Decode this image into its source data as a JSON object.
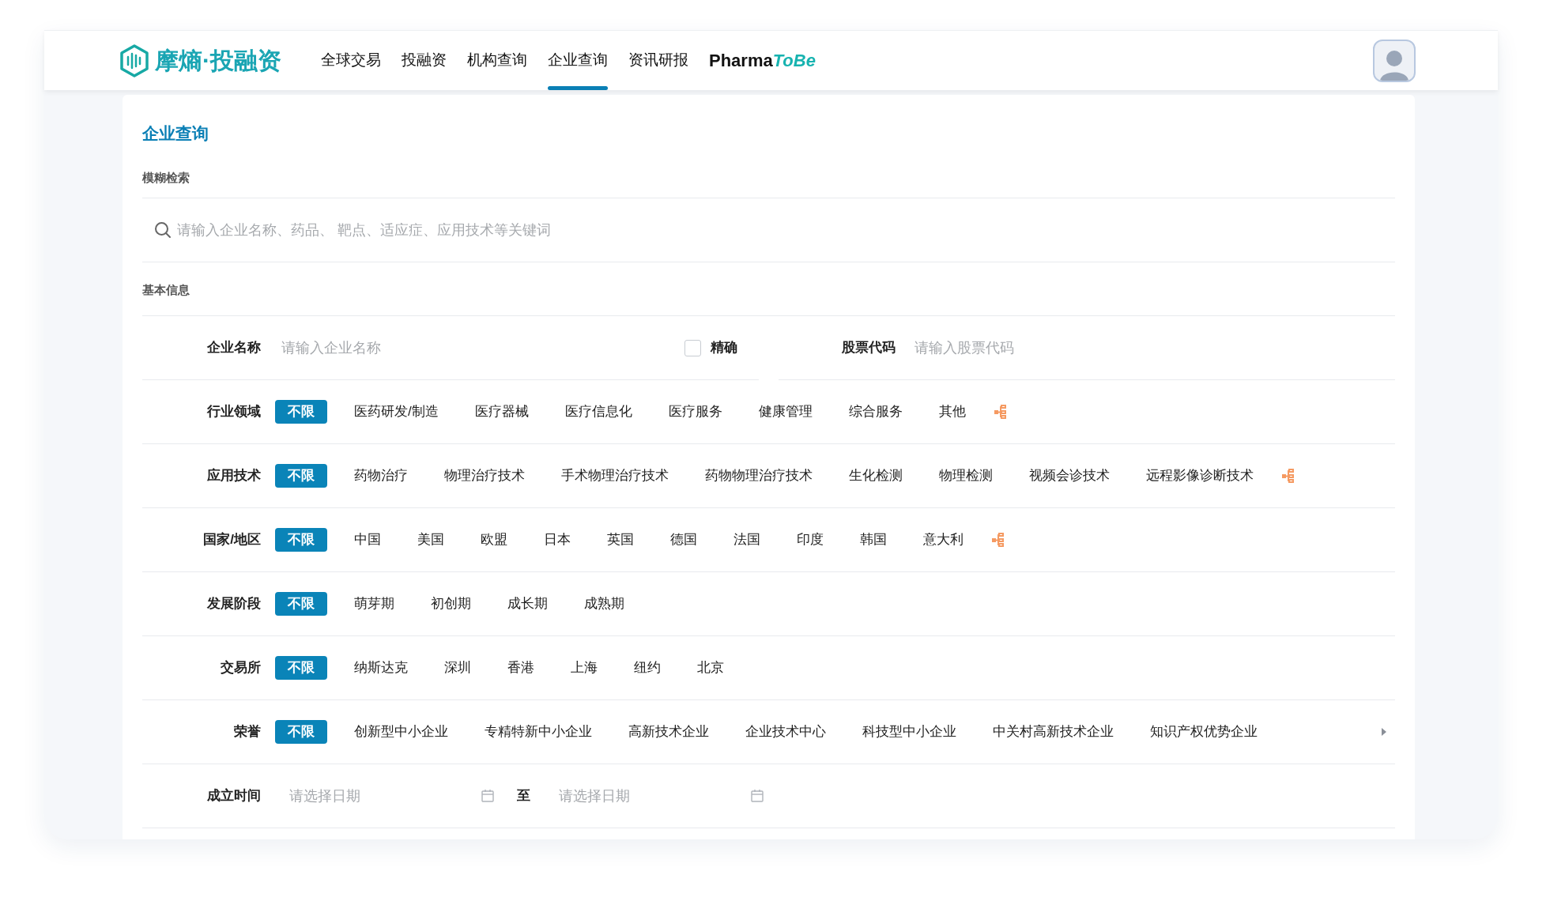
{
  "header": {
    "logo": "摩熵·投融资",
    "nav": [
      {
        "label": "全球交易",
        "selected": false
      },
      {
        "label": "投融资",
        "selected": false
      },
      {
        "label": "机构查询",
        "selected": false
      },
      {
        "label": "企业查询",
        "selected": true
      },
      {
        "label": "资讯研报",
        "selected": false
      }
    ],
    "brand_link": {
      "part_1": "Pharma",
      "part_2": "ToBe"
    }
  },
  "page_title": "企业查询",
  "fuzzy_search": {
    "section": "模糊检索",
    "placeholder": "请输入企业名称、药品、 靶点、适应症、应用技术等关键词"
  },
  "basic_info": {
    "section": "基本信息",
    "name_field": {
      "label": "企业名称",
      "placeholder": "请输入企业名称",
      "exact": {
        "label": "精确",
        "checked": false
      }
    },
    "stock_field": {
      "label": "股票代码",
      "placeholder": "请输入股票代码"
    },
    "filters": [
      {
        "label": "行业领域",
        "kind": "tree",
        "options": [
          {
            "label": "不限",
            "selected": true
          },
          {
            "label": "医药研发/制造",
            "selected": false
          },
          {
            "label": "医疗器械",
            "selected": false
          },
          {
            "label": "医疗信息化",
            "selected": false
          },
          {
            "label": "医疗服务",
            "selected": false
          },
          {
            "label": "健康管理",
            "selected": false
          },
          {
            "label": "综合服务",
            "selected": false
          },
          {
            "label": "其他",
            "selected": false
          }
        ]
      },
      {
        "label": "应用技术",
        "kind": "tree",
        "options": [
          {
            "label": "不限",
            "selected": true
          },
          {
            "label": "药物治疗",
            "selected": false
          },
          {
            "label": "物理治疗技术",
            "selected": false
          },
          {
            "label": "手术物理治疗技术",
            "selected": false
          },
          {
            "label": "药物物理治疗技术",
            "selected": false
          },
          {
            "label": "生化检测",
            "selected": false
          },
          {
            "label": "物理检测",
            "selected": false
          },
          {
            "label": "视频会诊技术",
            "selected": false
          },
          {
            "label": "远程影像诊断技术",
            "selected": false
          }
        ]
      },
      {
        "label": "国家/地区",
        "kind": "tree",
        "options": [
          {
            "label": "不限",
            "selected": true
          },
          {
            "label": "中国",
            "selected": false
          },
          {
            "label": "美国",
            "selected": false
          },
          {
            "label": "欧盟",
            "selected": false
          },
          {
            "label": "日本",
            "selected": false
          },
          {
            "label": "英国",
            "selected": false
          },
          {
            "label": "德国",
            "selected": false
          },
          {
            "label": "法国",
            "selected": false
          },
          {
            "label": "印度",
            "selected": false
          },
          {
            "label": "韩国",
            "selected": false
          },
          {
            "label": "意大利",
            "selected": false
          }
        ]
      },
      {
        "label": "发展阶段",
        "kind": "plain",
        "options": [
          {
            "label": "不限",
            "selected": true
          },
          {
            "label": "萌芽期",
            "selected": false
          },
          {
            "label": "初创期",
            "selected": false
          },
          {
            "label": "成长期",
            "selected": false
          },
          {
            "label": "成熟期",
            "selected": false
          }
        ]
      },
      {
        "label": "交易所",
        "kind": "plain",
        "options": [
          {
            "label": "不限",
            "selected": true
          },
          {
            "label": "纳斯达克",
            "selected": false
          },
          {
            "label": "深圳",
            "selected": false
          },
          {
            "label": "香港",
            "selected": false
          },
          {
            "label": "上海",
            "selected": false
          },
          {
            "label": "纽约",
            "selected": false
          },
          {
            "label": "北京",
            "selected": false
          }
        ]
      },
      {
        "label": "荣誉",
        "kind": "caret",
        "options": [
          {
            "label": "不限",
            "selected": true
          },
          {
            "label": "创新型中小企业",
            "selected": false
          },
          {
            "label": "专精特新中小企业",
            "selected": false
          },
          {
            "label": "高新技术企业",
            "selected": false
          },
          {
            "label": "企业技术中心",
            "selected": false
          },
          {
            "label": "科技型中小企业",
            "selected": false
          },
          {
            "label": "中关村高新技术企业",
            "selected": false
          },
          {
            "label": "知识产权优势企业",
            "selected": false
          }
        ]
      }
    ],
    "date": {
      "label": "成立时间",
      "start_placeholder": "请选择日期",
      "separator": "至",
      "end_placeholder": "请选择日期"
    }
  }
}
